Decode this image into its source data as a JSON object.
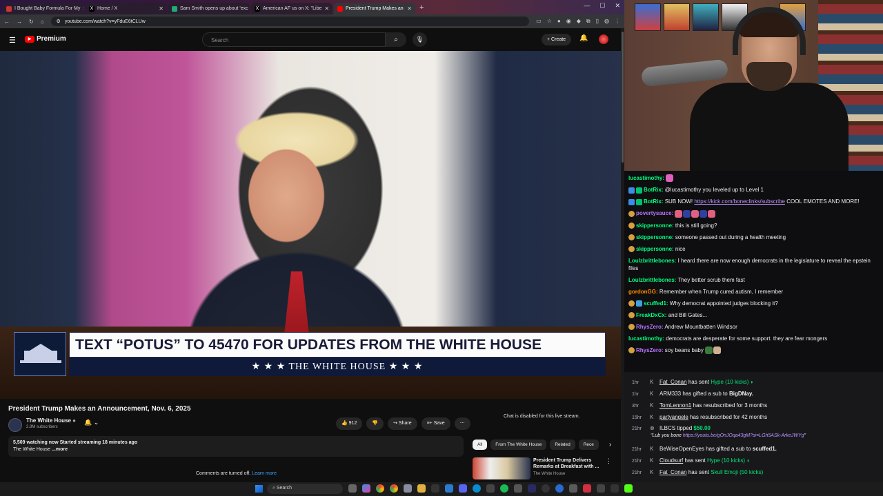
{
  "browser": {
    "tabs": [
      {
        "label": "I Bought Baby Formula For My",
        "color": "#c33"
      },
      {
        "label": "Home / X",
        "color": "#222"
      },
      {
        "label": "Sam Smith opens up about 'exc",
        "color": "#2a7"
      },
      {
        "label": "American AF us on X: \"Libe",
        "color": "#222"
      },
      {
        "label": "President Trump Makes an",
        "color": "#f00"
      }
    ],
    "new_tab": "+",
    "url": "youtube.com/watch?v=yFduE6tCLUw"
  },
  "youtube": {
    "logo": "Premium",
    "search_placeholder": "Search",
    "create_label": "Create",
    "video": {
      "chyron_text": "TEXT “POTUS” TO 45470 FOR UPDATES FROM THE WHITE HOUSE",
      "chyron_sub": "★ ★ ★   THE WHITE HOUSE   ★ ★ ★"
    },
    "title": "President Trump Makes an Announcement, Nov. 6, 2025",
    "channel": "The White House",
    "subscribers": "2.8M subscribers",
    "likes": "912",
    "share_label": "Share",
    "save_label": "Save",
    "description_line1": "5,509 watching now  Started streaming 18 minutes ago",
    "description_line2": "The White House",
    "description_more": "...more",
    "comments_off": "Comments are turned off.",
    "learn_more": "Learn more",
    "chat_disabled": "Chat is disabled for this live stream.",
    "chips": [
      "All",
      "From The White House",
      "Related",
      "Rece"
    ],
    "recommended": {
      "title": "President Trump Delivers Remarks at Breakfast with ...",
      "channel": "The White House"
    }
  },
  "taskbar": {
    "search_placeholder": "Search"
  },
  "chat": {
    "messages": [
      {
        "user": "lucastimothy:",
        "color": "#00ff7f",
        "text": ""
      },
      {
        "user": "BotRix:",
        "color": "#00ff7f",
        "text": "@lucastimothy you leveled up to Level 1"
      },
      {
        "user": "BotRix:",
        "color": "#00ff7f",
        "text": "SUB NOW! ",
        "link": "https://kick.com/boneclinks/subscribe",
        "text2": " COOL EMOTES AND MORE!"
      },
      {
        "user": "povertysauce:",
        "color": "#b974ff",
        "text": ""
      },
      {
        "user": "skippersonne:",
        "color": "#00ff7f",
        "text": "this is still going?"
      },
      {
        "user": "skippersonne:",
        "color": "#00ff7f",
        "text": "someone passed out during a health meeting"
      },
      {
        "user": "skippersonne:",
        "color": "#00ff7f",
        "text": "nice"
      },
      {
        "user": "Loulzbrittlebones:",
        "color": "#00ff7f",
        "text": "I heard there are now enough democrats in the legislature to reveal the epstein files"
      },
      {
        "user": "Loulzbrittlebones:",
        "color": "#00ff7f",
        "text": "They better scrub them fast"
      },
      {
        "user": "gordonGG:",
        "color": "#ff8c00",
        "text": "Remember when Trump cured autism, I remember"
      },
      {
        "user": "scuffed1:",
        "color": "#00ff7f",
        "text": "Why democrat appointed judges blocking it?"
      },
      {
        "user": "FreakDxCx:",
        "color": "#00ff7f",
        "text": "and Bill Gates..."
      },
      {
        "user": "RhysZero:",
        "color": "#b974ff",
        "text": "Andrew Mountbatten Windsor"
      },
      {
        "user": "lucastimothy:",
        "color": "#00ff7f",
        "text": "democrats are desperate for some support. they are fear mongers"
      },
      {
        "user": "RhysZero:",
        "color": "#b974ff",
        "text": "soy beans baby"
      }
    ]
  },
  "alerts": [
    {
      "time": "1hr",
      "user": "Fat_Conan",
      "text": " has sent ",
      "hype": "Hype (10 kicks)"
    },
    {
      "time": "1hr",
      "user": "ARM333",
      "text": " has gifted a sub to ",
      "bold": "BigDNay."
    },
    {
      "time": "3hr",
      "user": "TomLennon1",
      "text": " has resubscribed for 3 months"
    },
    {
      "time": "15hr",
      "user": "partyangele",
      "text": " has resubscribed for 42 months"
    },
    {
      "time": "21hr",
      "user": "ILBCS",
      "text": " tipped ",
      "hype": "$50.00",
      "note_prefix": "\"Lub you bone ",
      "note_link": "https://youtu.be/gOnJOqa43gM?si=LGh5ASk-ArkeJWYg",
      "note_suffix": "\""
    },
    {
      "time": "21hr",
      "user": "BeWiseOpenEyes",
      "text": " has gifted a sub to ",
      "bold": "scuffed1."
    },
    {
      "time": "21hr",
      "user": "Cloudsurf",
      "text": " has sent ",
      "hype": "Hype (10 kicks)"
    },
    {
      "time": "21hr",
      "user": "Fat_Conan",
      "text": " has sent ",
      "hype": "Skull Emoji (50 kicks)"
    }
  ]
}
